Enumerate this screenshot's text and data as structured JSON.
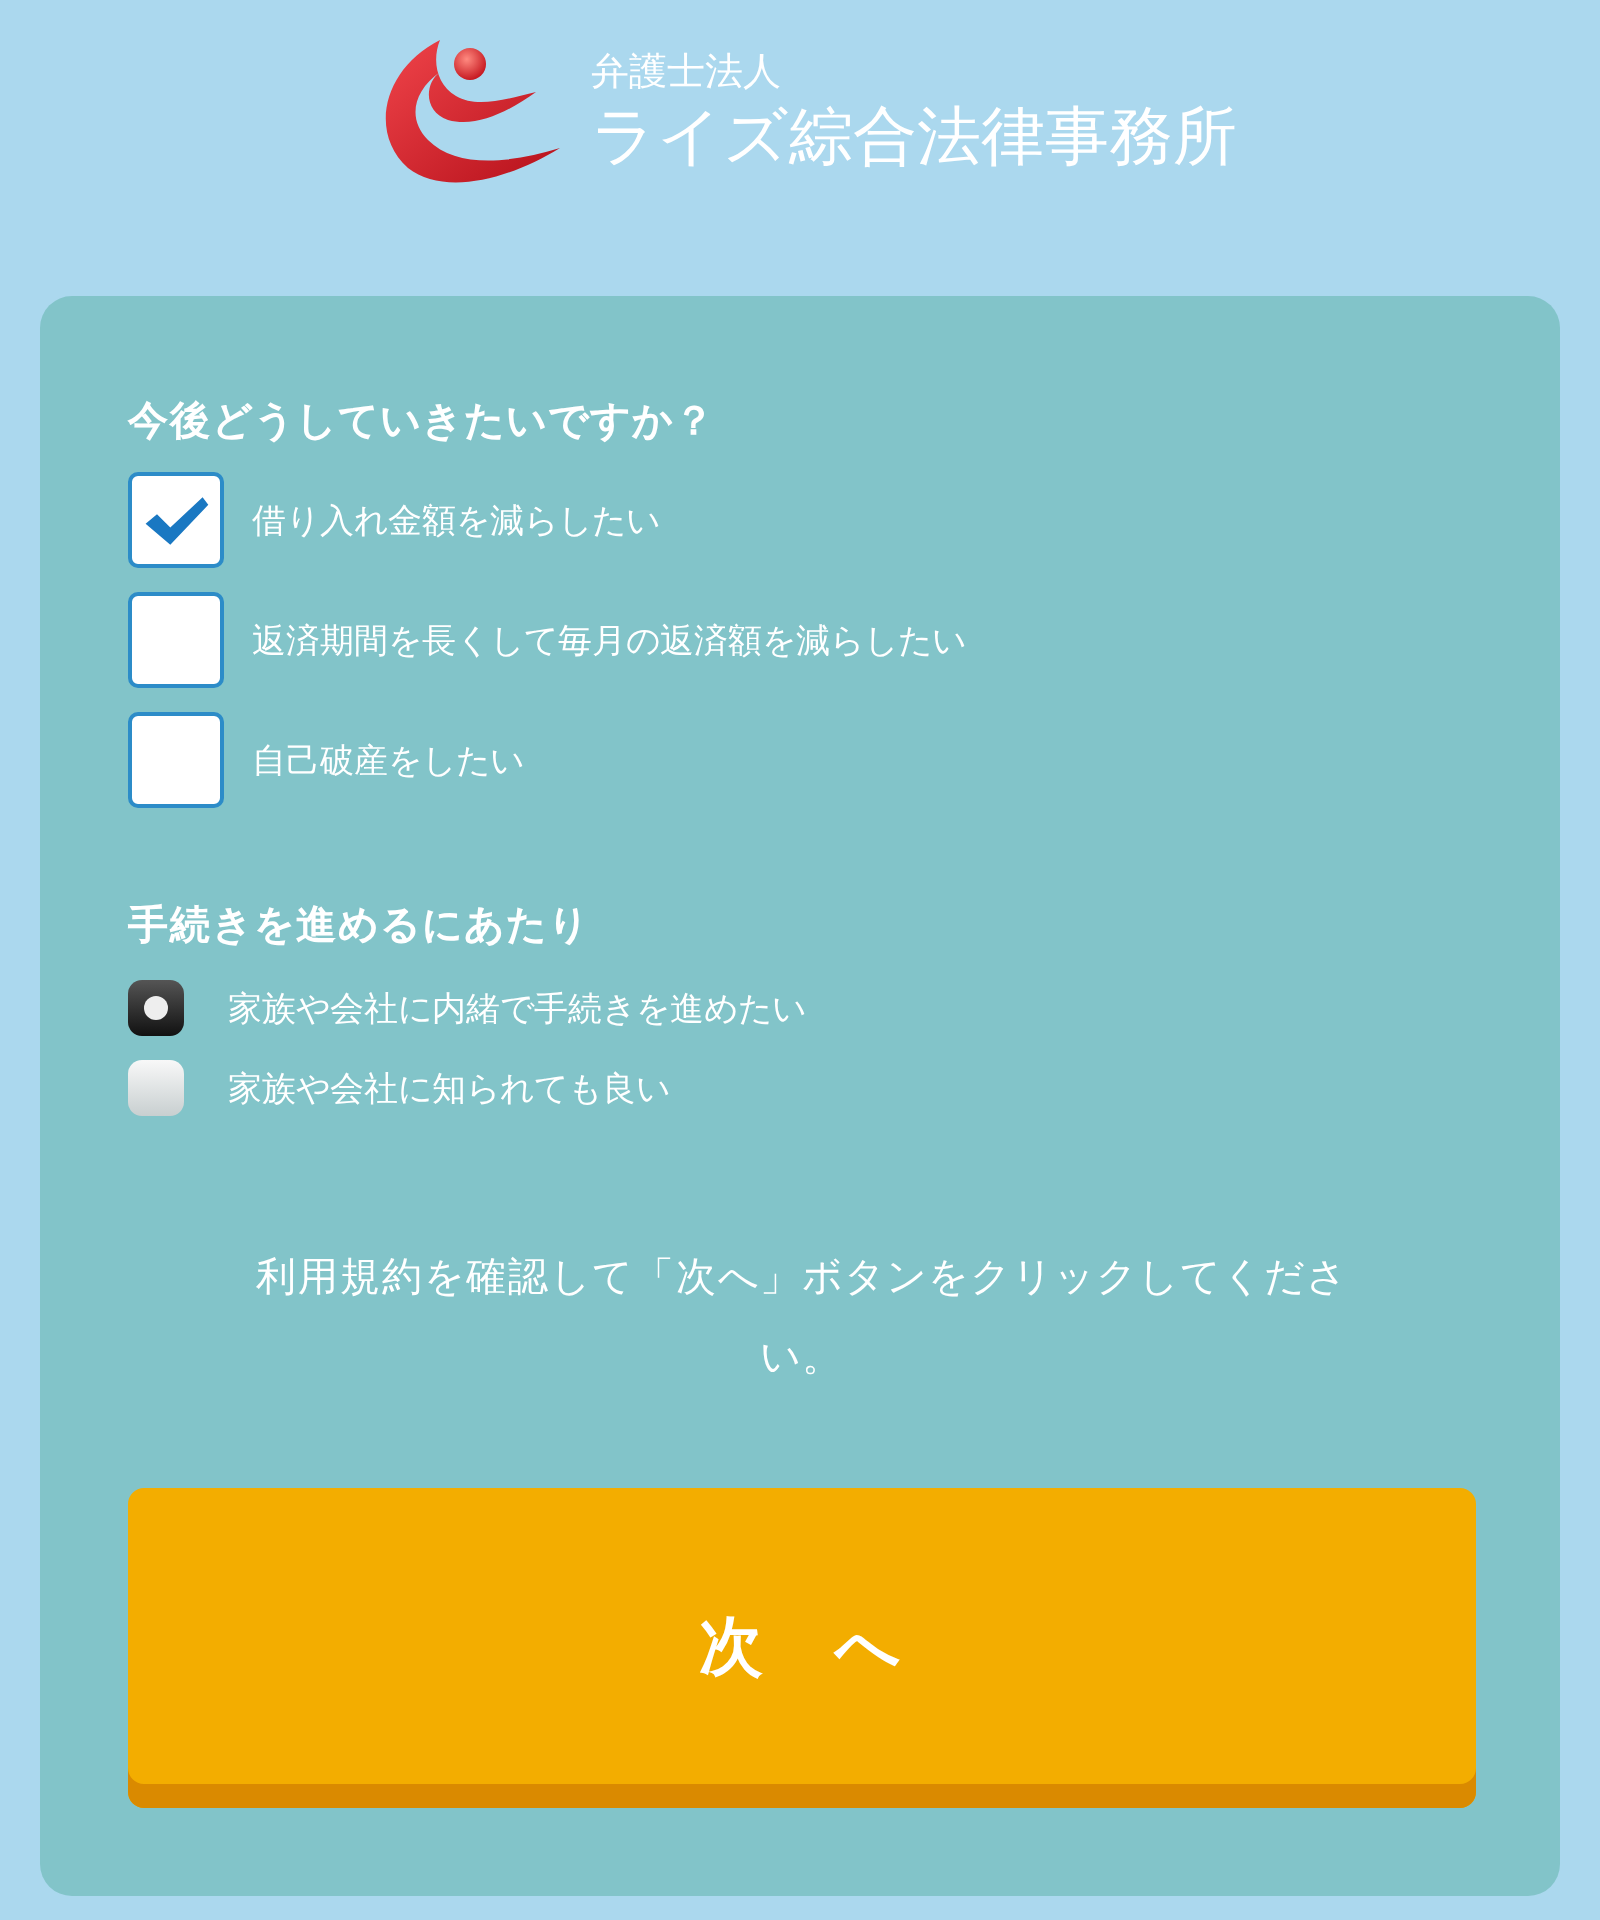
{
  "header": {
    "subtitle": "弁護士法人",
    "title": "ライズ綜合法律事務所"
  },
  "question": {
    "heading": "今後どうしていきたいですか？",
    "options": [
      {
        "label": "借り入れ金額を減らしたい",
        "checked": true
      },
      {
        "label": "返済期間を長くして毎月の返済額を減らしたい",
        "checked": false
      },
      {
        "label": "自己破産をしたい",
        "checked": false
      }
    ]
  },
  "procedure": {
    "heading": "手続きを進めるにあたり",
    "options": [
      {
        "label": "家族や会社に内緒で手続きを進めたい",
        "selected": true
      },
      {
        "label": "家族や会社に知られても良い",
        "selected": false
      }
    ]
  },
  "note": "利用規約を確認して「次へ」ボタンをクリックしてください。",
  "next_button": "次　へ"
}
